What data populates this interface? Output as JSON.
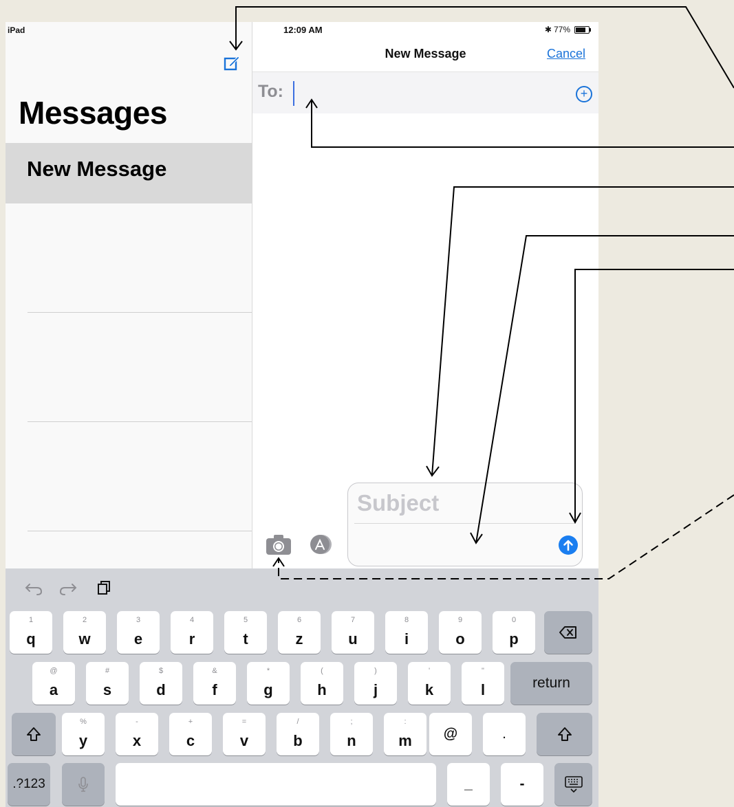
{
  "device_label": "iPad",
  "left_pane": {
    "title": "Messages",
    "selected_conversation": "New Message"
  },
  "status_bar": {
    "time": "12:09 AM",
    "bluetooth": "✱",
    "battery_percent": "77%"
  },
  "nav": {
    "title": "New Message",
    "cancel_label": "Cancel"
  },
  "to_field": {
    "label": "To:",
    "value": ""
  },
  "composer": {
    "subject_placeholder": "Subject",
    "message_value": ""
  },
  "keyboard": {
    "row1": [
      {
        "sub": "1",
        "main": "q"
      },
      {
        "sub": "2",
        "main": "w"
      },
      {
        "sub": "3",
        "main": "e"
      },
      {
        "sub": "4",
        "main": "r"
      },
      {
        "sub": "5",
        "main": "t"
      },
      {
        "sub": "6",
        "main": "z"
      },
      {
        "sub": "7",
        "main": "u"
      },
      {
        "sub": "8",
        "main": "i"
      },
      {
        "sub": "9",
        "main": "o"
      },
      {
        "sub": "0",
        "main": "p"
      }
    ],
    "row2": [
      {
        "sub": "@",
        "main": "a"
      },
      {
        "sub": "#",
        "main": "s"
      },
      {
        "sub": "$",
        "main": "d"
      },
      {
        "sub": "&",
        "main": "f"
      },
      {
        "sub": "*",
        "main": "g"
      },
      {
        "sub": "(",
        "main": "h"
      },
      {
        "sub": ")",
        "main": "j"
      },
      {
        "sub": "'",
        "main": "k"
      },
      {
        "sub": "\"",
        "main": "l"
      }
    ],
    "row3": [
      {
        "sub": "%",
        "main": "y"
      },
      {
        "sub": "-",
        "main": "x"
      },
      {
        "sub": "+",
        "main": "c"
      },
      {
        "sub": "=",
        "main": "v"
      },
      {
        "sub": "/",
        "main": "b"
      },
      {
        "sub": ";",
        "main": "n"
      },
      {
        "sub": ":",
        "main": "m"
      }
    ],
    "at_key": "@",
    "period_key": ".",
    "return_label": "return",
    "numbers_label": ".?123",
    "underscore_key": "_",
    "dash_key": "-"
  },
  "colors": {
    "accent": "#1a73d9",
    "send_button": "#1a7ef0",
    "keyboard_bg": "#d2d4d9",
    "page_bg": "#edeae0"
  }
}
